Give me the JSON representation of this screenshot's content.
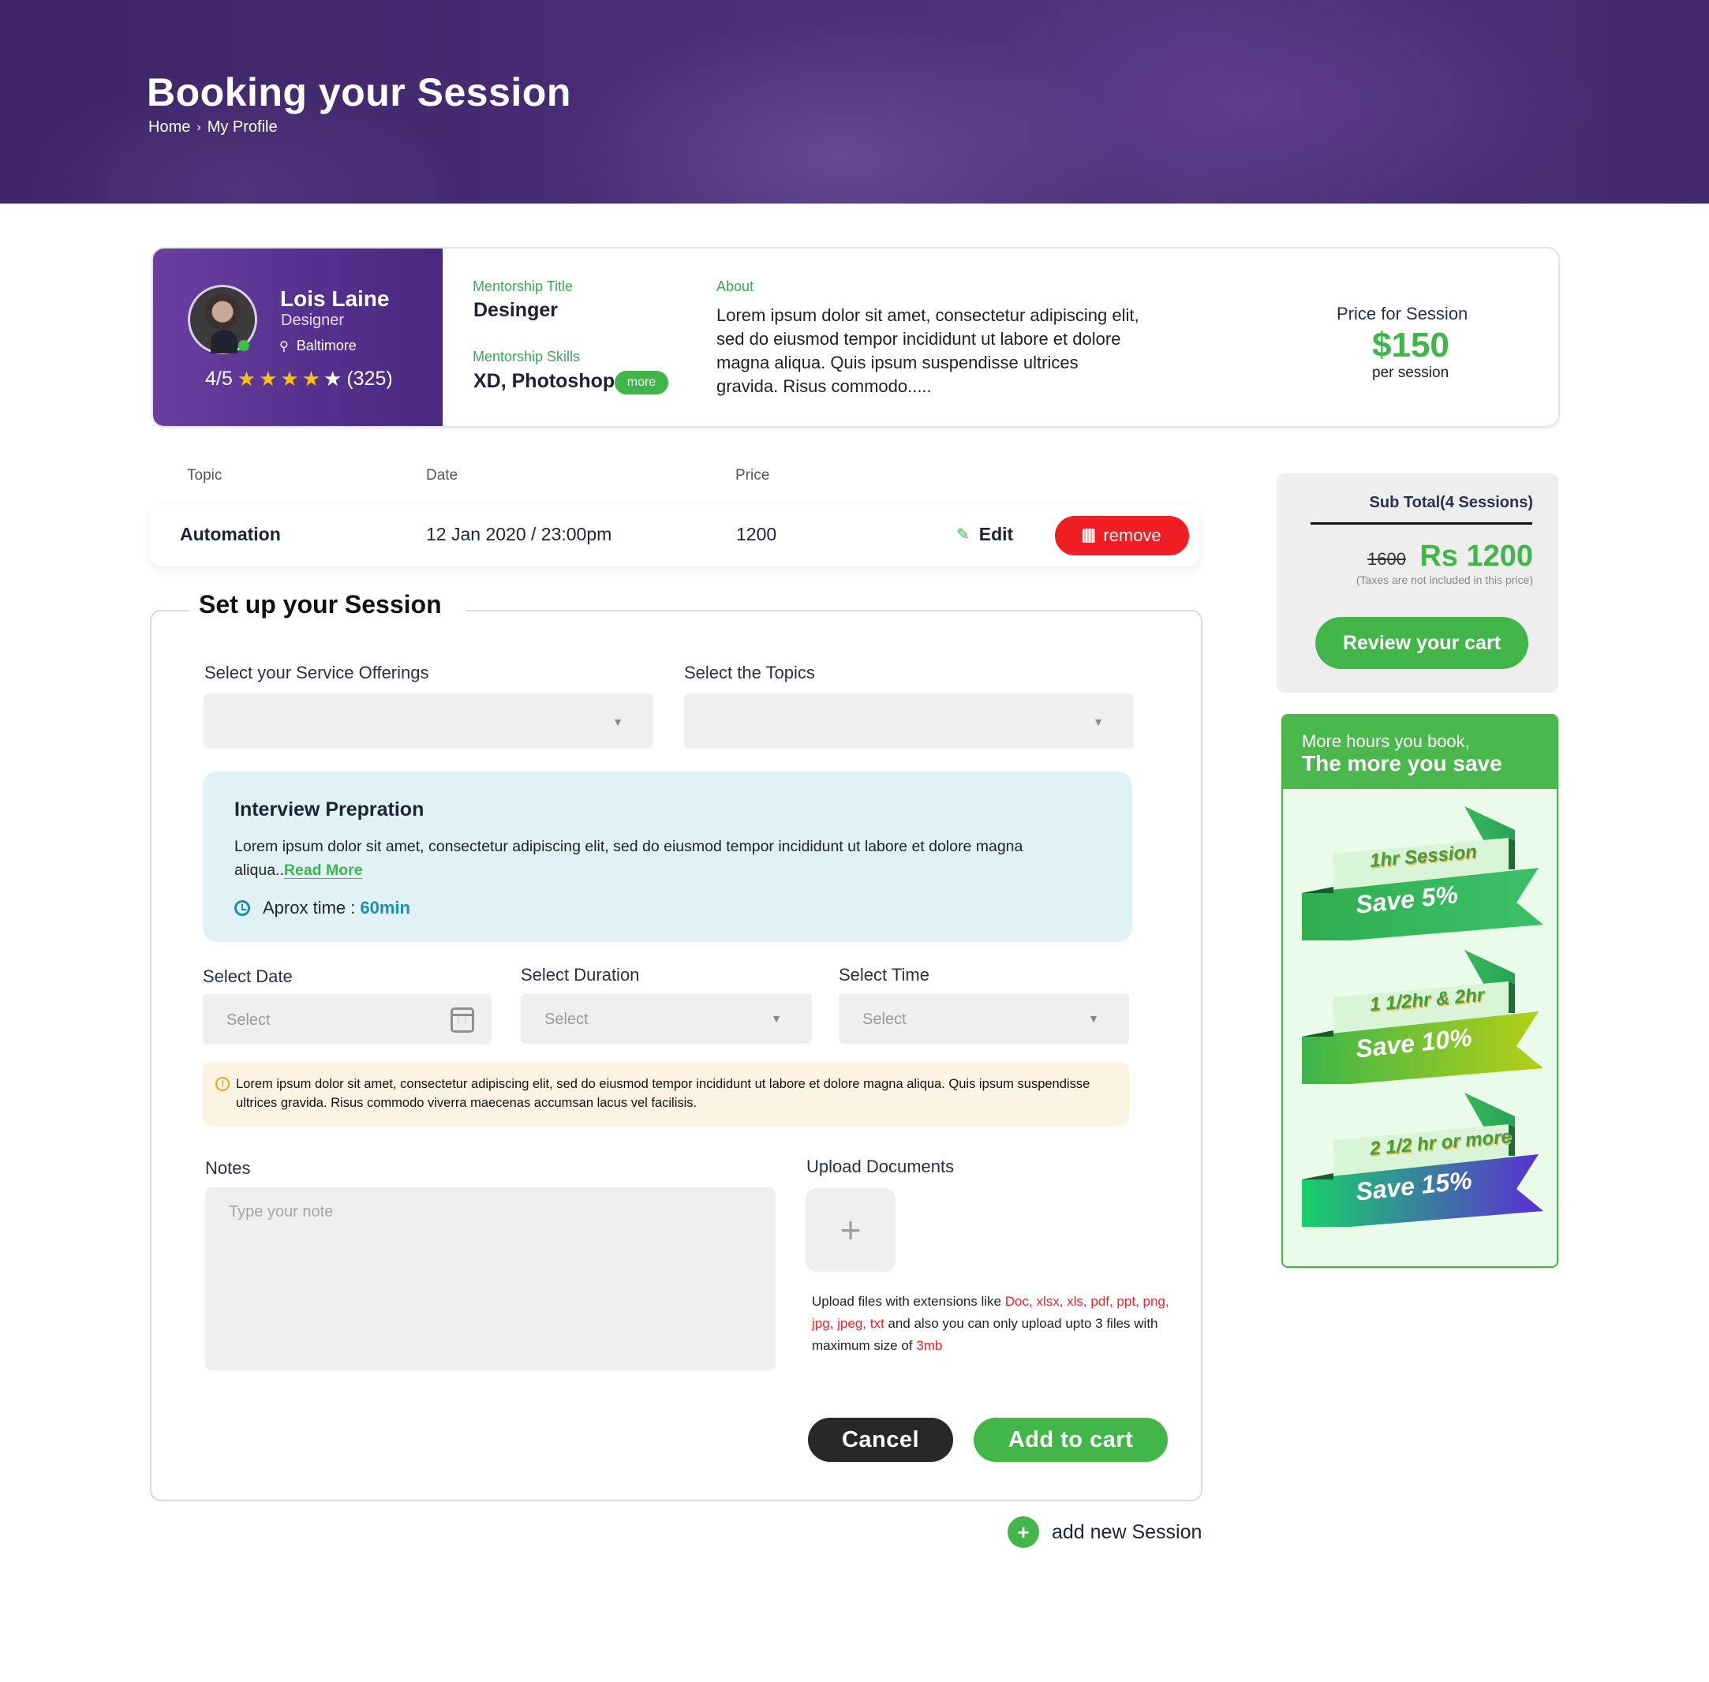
{
  "header": {
    "title": "Booking your Session",
    "breadcrumb": [
      "Home",
      "My Profile"
    ],
    "breadcrumb_sep": "›"
  },
  "mentor": {
    "name": "Lois Laine",
    "role": "Designer",
    "location": "Baltimore",
    "rating_text": "4/5",
    "rating_value": 4,
    "rating_max": 5,
    "review_count": "(325)",
    "online": true,
    "mentorship_title_label": "Mentorship Title",
    "mentorship_title": "Desinger",
    "mentorship_skills_label": "Mentorship Skills",
    "mentorship_skills": "XD, Photoshop",
    "more_label": "more",
    "about_label": "About",
    "about_text": "Lorem ipsum dolor sit amet, consectetur adipiscing elit, sed do eiusmod tempor incididunt ut labore et dolore magna aliqua. Quis ipsum suspendisse ultrices gravida. Risus commodo.....",
    "price_label": "Price for Session",
    "price": "$150",
    "price_unit": "per session"
  },
  "sessions_table": {
    "headers": [
      "Topic",
      "Date",
      "Price"
    ],
    "rows": [
      {
        "topic": "Automation",
        "date": "12 Jan 2020 / 23:00pm",
        "price": "1200",
        "edit_label": "Edit",
        "remove_label": "remove"
      }
    ]
  },
  "setup": {
    "title": "Set up your Session",
    "service_offerings_label": "Select your Service Offerings",
    "service_offerings_value": "",
    "topics_label": "Select the Topics",
    "topics_value": "",
    "offering": {
      "title": "Interview Prepration",
      "description": "Lorem ipsum dolor sit amet, consectetur adipiscing elit, sed do eiusmod tempor incididunt ut labore et dolore magna aliqua..",
      "read_more": "Read More",
      "aprox_label": "Aprox time :",
      "aprox_value": "60min"
    },
    "date_label": "Select Date",
    "date_placeholder": "Select",
    "duration_label": "Select Duration",
    "duration_placeholder": "Select",
    "time_label": "Select Time",
    "time_placeholder": "Select",
    "warning_text": "Lorem ipsum dolor sit amet, consectetur adipiscing elit, sed do eiusmod tempor incididunt ut labore et dolore magna aliqua. Quis ipsum suspendisse ultrices gravida. Risus commodo viverra maecenas accumsan lacus vel facilisis.",
    "notes_label": "Notes",
    "notes_placeholder": "Type your note",
    "upload_label": "Upload Documents",
    "upload_help_prefix": "Upload files with extensions like ",
    "upload_extensions": "Doc, xlsx, xls, pdf, ppt, png, jpg, jpeg, txt",
    "upload_help_middle": " and also you can only upload upto 3 files with maximum size of ",
    "upload_max_size": "3mb",
    "cancel_label": "Cancel",
    "add_to_cart_label": "Add to cart",
    "add_new_session_label": "add new Session"
  },
  "cart": {
    "subtotal_label": "Sub Total(4 Sessions)",
    "old_price": "1600",
    "new_price": "Rs 1200",
    "tax_note": "(Taxes are not included in this price)",
    "review_label": "Review your cart"
  },
  "savings": {
    "line1": "More hours you book,",
    "line2": "The more you save",
    "tiers": [
      {
        "duration": "1hr Session",
        "save": "Save 5%",
        "colors": [
          "#2fae4f",
          "#3cc06a"
        ]
      },
      {
        "duration": "1 1/2hr & 2hr",
        "save": "Save 10%",
        "colors": [
          "#3cb54a",
          "#b5cf18"
        ]
      },
      {
        "duration": "2 1/2 hr or more",
        "save": "Save 15%",
        "colors": [
          "#17d16a",
          "#5b2fd3"
        ]
      }
    ]
  },
  "colors": {
    "brand_purple": "#53308c",
    "accent_green": "#43b649",
    "danger_red": "#f01e22",
    "info_teal": "#1a93a8"
  }
}
